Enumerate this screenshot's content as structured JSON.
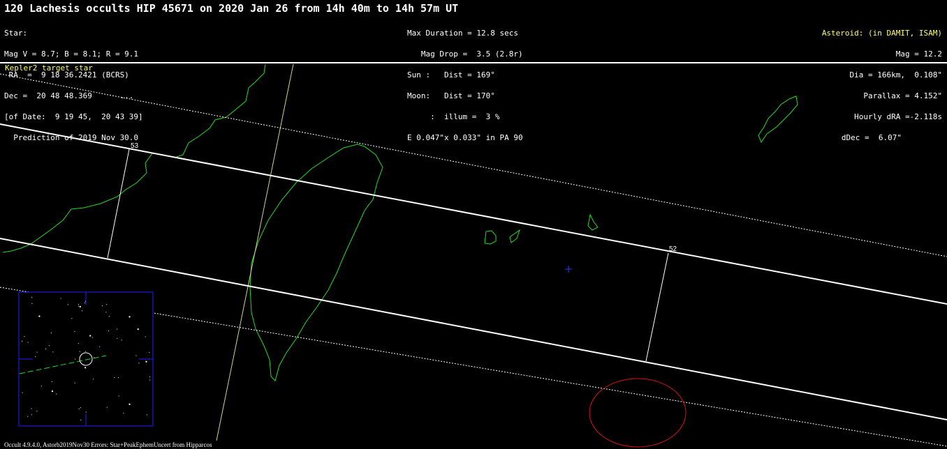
{
  "header": {
    "title": "120 Lachesis occults HIP 45671 on 2020 Jan 26 from 14h 40m to 14h 57m UT",
    "star_block": [
      "Star:",
      "Mag V = 8.7; B = 8.1; R = 9.1",
      " RA  =  9 18 36.2421 (BCRS)",
      "Dec =  20 48 48.369      ...",
      "[of Date:  9 19 45,  20 43 39]",
      "  Prediction of 2019 Nov 30.0"
    ],
    "event_block": [
      "Max Duration = 12.8 secs",
      "   Mag Drop =  3.5 (2.8r)",
      "Sun :   Dist = 169°",
      "Moon:   Dist = 170°",
      "     :  illum =  3 %",
      "E 0.047\"x 0.033\" in PA 90"
    ],
    "asteroid_title": "Asteroid: (in DAMIT, ISAM)",
    "asteroid_block": [
      "Mag = 12.2",
      "Dia = 166km,  0.108\"",
      "Parallax = 4.152\"",
      "Hourly dRA =-2.118s",
      "dDec =  6.07\""
    ]
  },
  "note": "Kepler2 target star",
  "footer": "Occult 4.9.4.0, Astorb2019Nov30 Errors: Star+PeakEphemUncert from Hipparcos",
  "map": {
    "time_labels": [
      "53",
      "52"
    ],
    "colors": {
      "coastline": "#22dd22",
      "path": "#ffffff",
      "error_ellipse": "#dd1111",
      "center_cross": "#3333ff",
      "finder_frame": "#2020ff",
      "text_highlight": "#ffff60"
    }
  }
}
